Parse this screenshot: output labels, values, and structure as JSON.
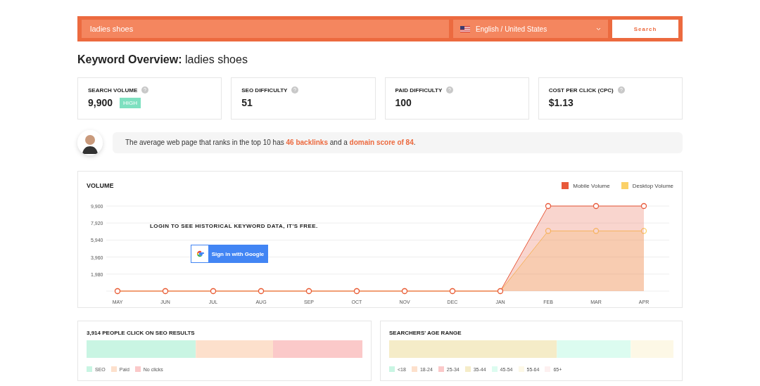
{
  "search": {
    "query": "ladies shoes",
    "language": "English / United States",
    "button": "Search"
  },
  "heading": {
    "label": "Keyword Overview:",
    "keyword": "ladies shoes"
  },
  "metrics": [
    {
      "label": "SEARCH VOLUME",
      "value": "9,900",
      "badge": "HIGH"
    },
    {
      "label": "SEO DIFFICULTY",
      "value": "51"
    },
    {
      "label": "PAID DIFFICULTY",
      "value": "100"
    },
    {
      "label": "COST PER CLICK (CPC)",
      "value": "$1.13"
    }
  ],
  "insight": "The average web page that ranks in the top 10 has **46 backlinks** and a **domain score of 84**.",
  "volume": {
    "title": "VOLUME",
    "login_prompt": "LOGIN TO SEE HISTORICAL KEYWORD DATA, IT'S FREE.",
    "signin_button": "Sign in with Google",
    "chart_data": {
      "type": "area",
      "categories": [
        "MAY",
        "JUN",
        "JUL",
        "AUG",
        "SEP",
        "OCT",
        "NOV",
        "DEC",
        "JAN",
        "FEB",
        "MAR",
        "APR"
      ],
      "ylim": [
        0,
        9900
      ],
      "grid": true,
      "yticks": [
        {
          "value": 1980,
          "label": "1,980"
        },
        {
          "value": 3960,
          "label": "3,960"
        },
        {
          "value": 5940,
          "label": "5,940"
        },
        {
          "value": 7920,
          "label": "7,920"
        },
        {
          "value": 9900,
          "label": "9,900"
        }
      ],
      "series": [
        {
          "name": "Mobile Volume",
          "color": "#e8593a",
          "values": [
            0,
            0,
            0,
            0,
            0,
            0,
            0,
            0,
            0,
            9900,
            9900,
            9900
          ]
        },
        {
          "name": "Desktop Volume",
          "color": "#fbd168",
          "values": [
            0,
            0,
            0,
            0,
            0,
            0,
            0,
            0,
            0,
            7000,
            7000,
            7000
          ]
        }
      ]
    }
  },
  "clicks": {
    "title": "3,914 PEOPLE CLICK ON SEO RESULTS",
    "segments": [
      {
        "label": "SEO",
        "color": "#c9f5e3"
      },
      {
        "label": "Paid",
        "color": "#fde0cc"
      },
      {
        "label": "No clicks",
        "color": "#fbc9c9"
      }
    ]
  },
  "age": {
    "title": "SEARCHERS' AGE RANGE",
    "segments": [
      {
        "label": "<18",
        "color": "#c9f5e3"
      },
      {
        "label": "18-24",
        "color": "#fde0cc"
      },
      {
        "label": "25-34",
        "color": "#fbc9c9"
      },
      {
        "label": "35-44",
        "color": "#f5ecc8"
      },
      {
        "label": "45-54",
        "color": "#dcfcf0"
      },
      {
        "label": "55-64",
        "color": "#fdf8e6"
      },
      {
        "label": "65+",
        "color": "#fdf0f0"
      }
    ]
  }
}
